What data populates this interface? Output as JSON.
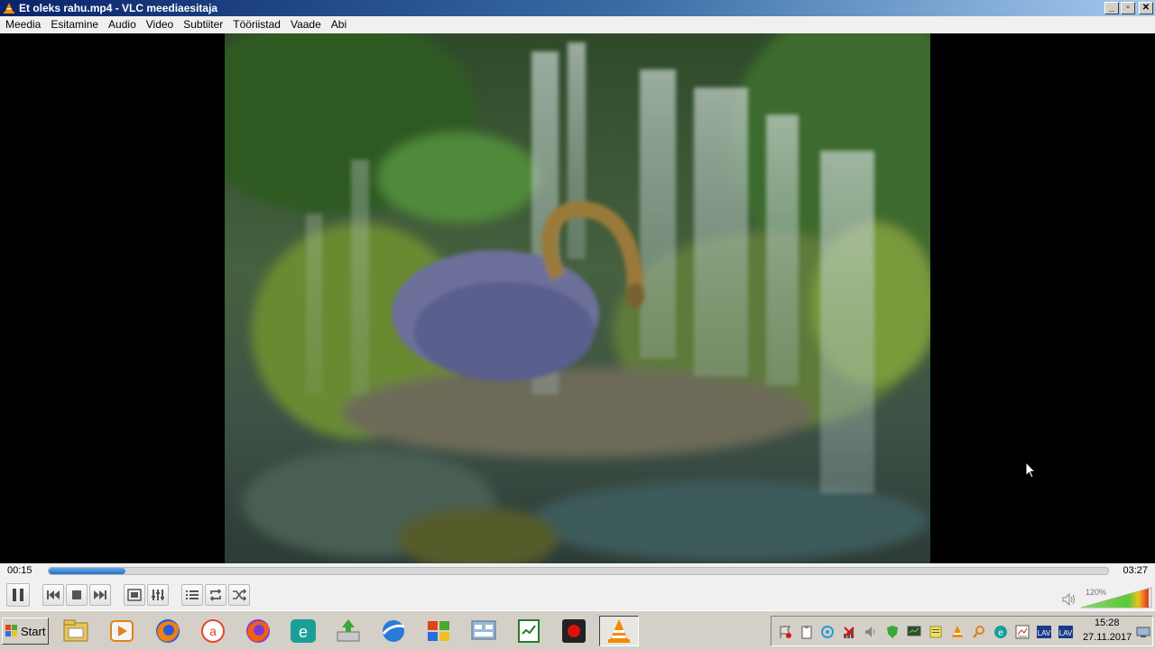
{
  "window": {
    "title": "Et oleks rahu.mp4 - VLC meediaesitaja",
    "buttons": {
      "minimize": "_",
      "maximize": "▫",
      "close": "✕"
    }
  },
  "menu": [
    "Meedia",
    "Esitamine",
    "Audio",
    "Video",
    "Subtiiter",
    "Tööriistad",
    "Vaade",
    "Abi"
  ],
  "player": {
    "current_time": "00:15",
    "total_time": "03:27",
    "progress": 0.072,
    "volume_label": "120%",
    "volume_level": 1.2
  },
  "controls": [
    "pause-icon",
    "previous-icon",
    "stop-icon",
    "next-icon",
    "fullscreen-icon",
    "extended-settings-icon",
    "playlist-icon",
    "loop-icon",
    "shuffle-icon"
  ],
  "taskbar": {
    "start_label": "Start",
    "apps": [
      "file-manager-icon",
      "media-player-icon",
      "firefox-icon",
      "avast-icon",
      "firefox-icon",
      "eset-icon",
      "disk-utility-icon",
      "browser-icon",
      "system-icon",
      "network-icon",
      "notepad-icon",
      "recorder-icon",
      "vlc-icon"
    ],
    "clock_time": "15:28",
    "clock_date": "27.11.2017"
  },
  "colors": {
    "accent": "#1f6fc9",
    "title_start": "#0a246a",
    "vlc_orange": "#f08c00"
  }
}
